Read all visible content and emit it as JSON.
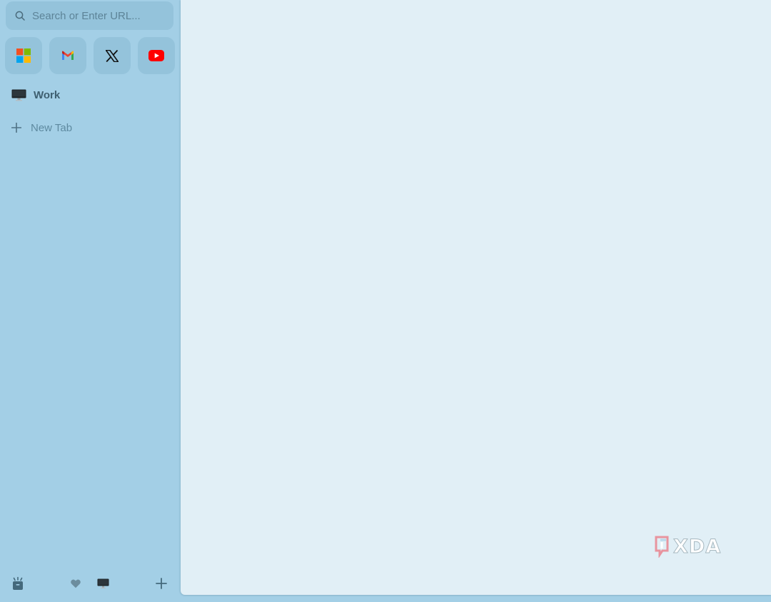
{
  "sidebar": {
    "search": {
      "placeholder": "Search or Enter URL..."
    },
    "favorites": [
      {
        "icon": "microsoft-icon"
      },
      {
        "icon": "gmail-icon"
      },
      {
        "icon": "x-icon"
      },
      {
        "icon": "youtube-icon"
      }
    ],
    "tabs": [
      {
        "label": "Work",
        "icon": "monitor-icon"
      }
    ],
    "new_tab_label": "New Tab",
    "bottom_icons": [
      "archive-icon",
      "heart-icon",
      "monitor-icon",
      "plus-icon"
    ]
  },
  "watermark": {
    "text": "XDA"
  },
  "colors": {
    "sidebar_bg": "#a3cfe6",
    "tile_bg": "#94c3db",
    "content_bg": "#e1eff6"
  }
}
